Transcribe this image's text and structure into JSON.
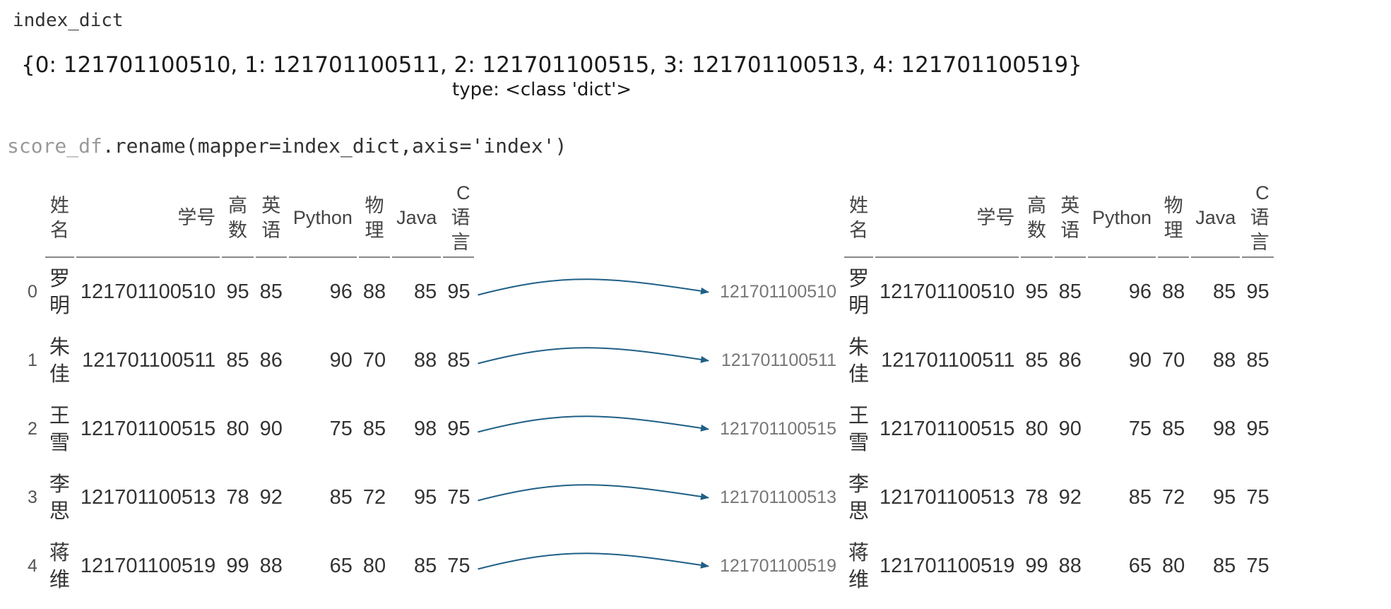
{
  "code1": "index_dict",
  "dict_output": "{0: 121701100510, 1: 121701100511, 2: 121701100515, 3: 121701100513, 4: 121701100519}",
  "type_output": "type: <class 'dict'>",
  "code2": {
    "var": "score_df",
    "rest": ".rename(mapper=index_dict,axis='index')"
  },
  "columns": [
    {
      "lines": [
        "姓",
        "名"
      ]
    },
    {
      "lines": [
        "学号"
      ]
    },
    {
      "lines": [
        "高",
        "数"
      ]
    },
    {
      "lines": [
        "英",
        "语"
      ]
    },
    {
      "lines": [
        "Python"
      ]
    },
    {
      "lines": [
        "物",
        "理"
      ]
    },
    {
      "lines": [
        "Java"
      ]
    },
    {
      "lines": [
        "C",
        "语",
        "言"
      ]
    }
  ],
  "rows": [
    {
      "index": "0",
      "name": [
        "罗",
        "明"
      ],
      "id": "121701100510",
      "gaoshu": "95",
      "yingyu": "85",
      "python": "96",
      "wuli": "88",
      "java": "85",
      "c": "95"
    },
    {
      "index": "1",
      "name": [
        "朱",
        "佳"
      ],
      "id": "121701100511",
      "gaoshu": "85",
      "yingyu": "86",
      "python": "90",
      "wuli": "70",
      "java": "88",
      "c": "85"
    },
    {
      "index": "2",
      "name": [
        "王",
        "雪"
      ],
      "id": "121701100515",
      "gaoshu": "80",
      "yingyu": "90",
      "python": "75",
      "wuli": "85",
      "java": "98",
      "c": "95"
    },
    {
      "index": "3",
      "name": [
        "李",
        "思"
      ],
      "id": "121701100513",
      "gaoshu": "78",
      "yingyu": "92",
      "python": "85",
      "wuli": "72",
      "java": "95",
      "c": "75"
    },
    {
      "index": "4",
      "name": [
        "蒋",
        "维"
      ],
      "id": "121701100519",
      "gaoshu": "99",
      "yingyu": "88",
      "python": "65",
      "wuli": "80",
      "java": "85",
      "c": "75"
    }
  ],
  "new_index": [
    "121701100510",
    "121701100511",
    "121701100515",
    "121701100513",
    "121701100519"
  ],
  "colors": {
    "arrow": "#1f5f86",
    "text": "#333333",
    "code_var": "#9a9a9a"
  }
}
